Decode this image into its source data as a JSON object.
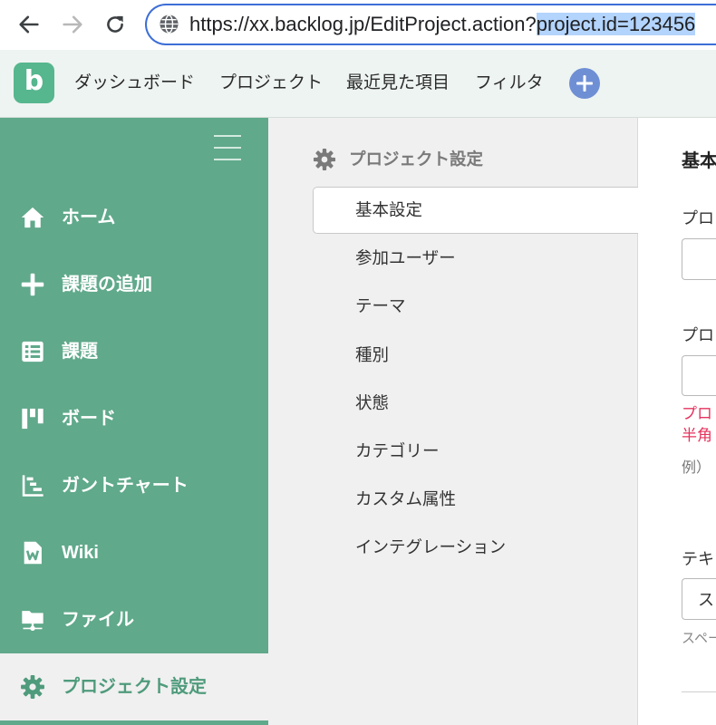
{
  "browser": {
    "url_unselected": "https://xx.backlog.jp/EditProject.action?",
    "url_selected": "project.id=123456",
    "icons": {
      "back": "arrow-left-icon",
      "forward": "arrow-right-icon",
      "reload": "reload-icon",
      "site_info": "globe-icon"
    }
  },
  "app_header": {
    "logo_letter": "b",
    "nav": [
      "ダッシュボード",
      "プロジェクト",
      "最近見た項目",
      "フィルタ"
    ],
    "add_button_icon": "plus-circle-icon"
  },
  "sidebar": {
    "toggle_icon": "hamburger-icon",
    "items": [
      {
        "label": "ホーム",
        "icon": "home-icon",
        "active": false
      },
      {
        "label": "課題の追加",
        "icon": "plus-icon",
        "active": false
      },
      {
        "label": "課題",
        "icon": "list-icon",
        "active": false
      },
      {
        "label": "ボード",
        "icon": "board-icon",
        "active": false
      },
      {
        "label": "ガントチャート",
        "icon": "gantt-chart-icon",
        "active": false
      },
      {
        "label": "Wiki",
        "icon": "wiki-document-icon",
        "active": false
      },
      {
        "label": "ファイル",
        "icon": "folder-icon",
        "active": false
      },
      {
        "label": "プロジェクト設定",
        "icon": "gear-icon",
        "active": true
      }
    ]
  },
  "settings_menu": {
    "title": "プロジェクト設定",
    "title_icon": "gear-icon",
    "items": [
      {
        "label": "基本設定",
        "selected": true
      },
      {
        "label": "参加ユーザー",
        "selected": false
      },
      {
        "label": "テーマ",
        "selected": false
      },
      {
        "label": "種別",
        "selected": false
      },
      {
        "label": "状態",
        "selected": false
      },
      {
        "label": "カテゴリー",
        "selected": false
      },
      {
        "label": "カスタム属性",
        "selected": false
      },
      {
        "label": "インテグレーション",
        "selected": false
      }
    ]
  },
  "content": {
    "heading": "基本",
    "field_1_label": "プロ",
    "field_2_label": "プロ",
    "field_2_error_lines": [
      "プロ",
      "半角"
    ],
    "field_2_example": "例）",
    "field_3_label": "テキ",
    "field_3_value": "ス",
    "field_3_hint": "スペー"
  },
  "theme": {
    "sidebar_green": "#60a98b",
    "active_green": "#4f9b7c",
    "logo_green": "#56b68e",
    "header_bg": "#eef4f1",
    "panel_gray": "#f0f0f0",
    "add_button_blue": "#6f8fd5",
    "url_focus_blue": "#3d6ed7",
    "selection_blue": "#b3d4fc",
    "error_red": "#e5335e"
  }
}
